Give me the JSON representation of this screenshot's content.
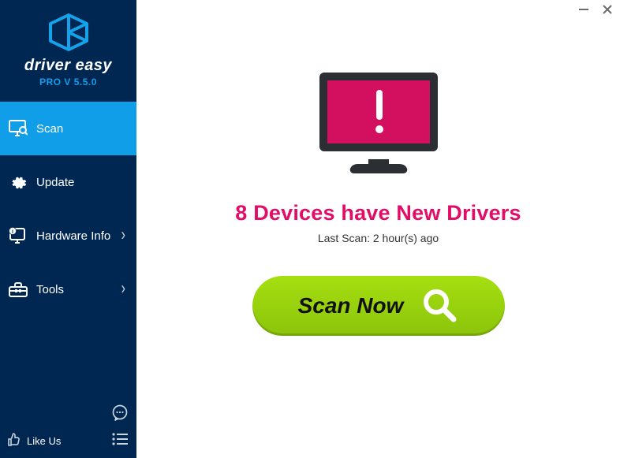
{
  "brand": {
    "name": "driver easy",
    "version_label": "PRO V 5.5.0"
  },
  "sidebar": {
    "items": [
      {
        "label": "Scan",
        "active": true
      },
      {
        "label": "Update",
        "active": false
      },
      {
        "label": "Hardware Info",
        "active": false,
        "has_sub": true
      },
      {
        "label": "Tools",
        "active": false,
        "has_sub": true
      }
    ],
    "like_us_label": "Like Us"
  },
  "main": {
    "headline": "8 Devices have New Drivers",
    "last_scan_label": "Last Scan: 2 hour(s) ago",
    "scan_button_label": "Scan Now"
  }
}
